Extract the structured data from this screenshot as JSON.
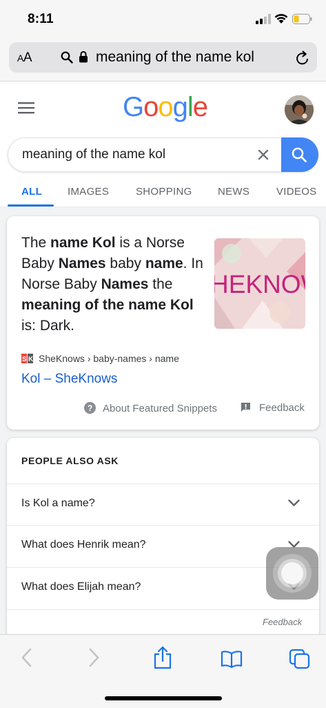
{
  "status_bar": {
    "time": "8:11"
  },
  "safari": {
    "text_size_label_large": "A",
    "text_size_label_small": "A",
    "url_text": "meaning of the name kol"
  },
  "google": {
    "logo_letters": [
      {
        "char": "G",
        "color": "#4285f4"
      },
      {
        "char": "o",
        "color": "#ea4335"
      },
      {
        "char": "o",
        "color": "#fbbc05"
      },
      {
        "char": "g",
        "color": "#4285f4"
      },
      {
        "char": "l",
        "color": "#34a853"
      },
      {
        "char": "e",
        "color": "#ea4335"
      }
    ],
    "search_query": "meaning of the name kol",
    "tabs": [
      {
        "label": "ALL"
      },
      {
        "label": "IMAGES"
      },
      {
        "label": "SHOPPING"
      },
      {
        "label": "NEWS"
      },
      {
        "label": "VIDEOS"
      }
    ]
  },
  "snippet": {
    "text_segments": [
      {
        "t": "The ",
        "b": false
      },
      {
        "t": "name Kol",
        "b": true
      },
      {
        "t": " is a Norse Baby ",
        "b": false
      },
      {
        "t": "Names",
        "b": true
      },
      {
        "t": " baby ",
        "b": false
      },
      {
        "t": "name",
        "b": true
      },
      {
        "t": ". In Norse Baby ",
        "b": false
      },
      {
        "t": "Names",
        "b": true
      },
      {
        "t": " the ",
        "b": false
      },
      {
        "t": "meaning of the name Kol",
        "b": true
      },
      {
        "t": " is: Dark.",
        "b": false
      }
    ],
    "thumbnail_text": "HEKNOW",
    "source": "SheKnows › baby-names › name",
    "link_title": "Kol – SheKnows",
    "about_label": "About Featured Snippets",
    "feedback_label": "Feedback"
  },
  "people_also_ask": {
    "title": "PEOPLE ALSO ASK",
    "questions": [
      "Is Kol a name?",
      "What does Henrik mean?",
      "What does Elijah mean?"
    ],
    "feedback_label": "Feedback"
  },
  "colors": {
    "accent": "#1a73e8",
    "link": "#1a5fc9",
    "search_button": "#4285f4"
  }
}
